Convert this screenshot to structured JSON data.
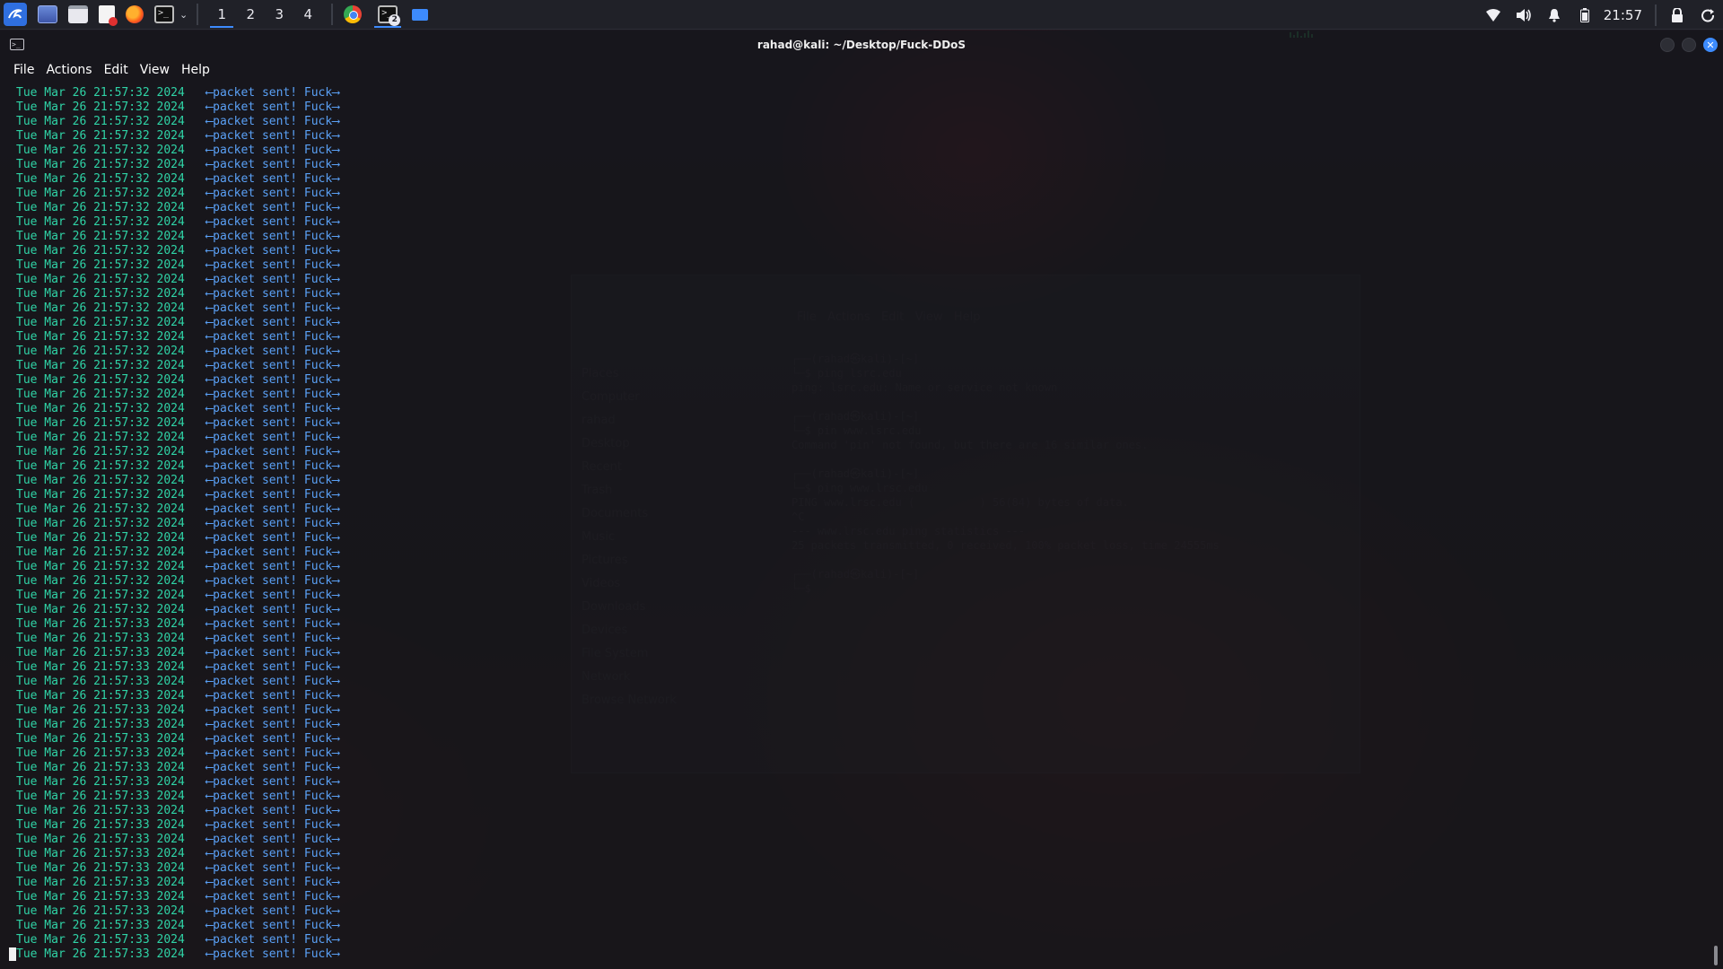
{
  "taskbar": {
    "workspaces": [
      "1",
      "2",
      "3",
      "4"
    ],
    "active_workspace": "1",
    "terminal_badge": "2",
    "clock": "21:57"
  },
  "window": {
    "title": "rahad@kali: ~/Desktop/Fuck-DDoS",
    "menu": [
      "File",
      "Actions",
      "Edit",
      "View",
      "Help"
    ]
  },
  "terminal": {
    "message": "⟵packet sent! Fuck⟶",
    "lines": [
      "Tue Mar 26 21:57:32 2024",
      "Tue Mar 26 21:57:32 2024",
      "Tue Mar 26 21:57:32 2024",
      "Tue Mar 26 21:57:32 2024",
      "Tue Mar 26 21:57:32 2024",
      "Tue Mar 26 21:57:32 2024",
      "Tue Mar 26 21:57:32 2024",
      "Tue Mar 26 21:57:32 2024",
      "Tue Mar 26 21:57:32 2024",
      "Tue Mar 26 21:57:32 2024",
      "Tue Mar 26 21:57:32 2024",
      "Tue Mar 26 21:57:32 2024",
      "Tue Mar 26 21:57:32 2024",
      "Tue Mar 26 21:57:32 2024",
      "Tue Mar 26 21:57:32 2024",
      "Tue Mar 26 21:57:32 2024",
      "Tue Mar 26 21:57:32 2024",
      "Tue Mar 26 21:57:32 2024",
      "Tue Mar 26 21:57:32 2024",
      "Tue Mar 26 21:57:32 2024",
      "Tue Mar 26 21:57:32 2024",
      "Tue Mar 26 21:57:32 2024",
      "Tue Mar 26 21:57:32 2024",
      "Tue Mar 26 21:57:32 2024",
      "Tue Mar 26 21:57:32 2024",
      "Tue Mar 26 21:57:32 2024",
      "Tue Mar 26 21:57:32 2024",
      "Tue Mar 26 21:57:32 2024",
      "Tue Mar 26 21:57:32 2024",
      "Tue Mar 26 21:57:32 2024",
      "Tue Mar 26 21:57:32 2024",
      "Tue Mar 26 21:57:32 2024",
      "Tue Mar 26 21:57:32 2024",
      "Tue Mar 26 21:57:32 2024",
      "Tue Mar 26 21:57:32 2024",
      "Tue Mar 26 21:57:32 2024",
      "Tue Mar 26 21:57:32 2024",
      "Tue Mar 26 21:57:33 2024",
      "Tue Mar 26 21:57:33 2024",
      "Tue Mar 26 21:57:33 2024",
      "Tue Mar 26 21:57:33 2024",
      "Tue Mar 26 21:57:33 2024",
      "Tue Mar 26 21:57:33 2024",
      "Tue Mar 26 21:57:33 2024",
      "Tue Mar 26 21:57:33 2024",
      "Tue Mar 26 21:57:33 2024",
      "Tue Mar 26 21:57:33 2024",
      "Tue Mar 26 21:57:33 2024",
      "Tue Mar 26 21:57:33 2024",
      "Tue Mar 26 21:57:33 2024",
      "Tue Mar 26 21:57:33 2024",
      "Tue Mar 26 21:57:33 2024",
      "Tue Mar 26 21:57:33 2024",
      "Tue Mar 26 21:57:33 2024",
      "Tue Mar 26 21:57:33 2024",
      "Tue Mar 26 21:57:33 2024",
      "Tue Mar 26 21:57:33 2024",
      "Tue Mar 26 21:57:33 2024",
      "Tue Mar 26 21:57:33 2024",
      "Tue Mar 26 21:57:33 2024",
      "Tue Mar 26 21:57:33 2024"
    ]
  },
  "colors": {
    "timestamp": "#2fd3a6",
    "message": "#5aa0f5",
    "accent": "#3d8bfd"
  }
}
